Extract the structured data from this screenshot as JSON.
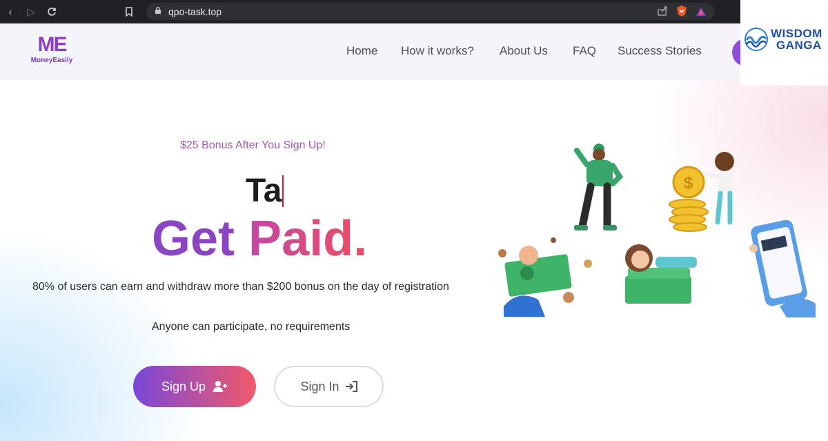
{
  "browser": {
    "url": "qpo-task.top",
    "icons": [
      "back-icon",
      "forward-icon",
      "reload-icon",
      "bookmark-icon",
      "lock-icon",
      "share-icon",
      "brave-shield-icon",
      "rewards-icon"
    ]
  },
  "watermark": {
    "line1": "WISDOM",
    "line2": "GANGA"
  },
  "site": {
    "logo_letters": "ME",
    "logo_name": "MoneyEasily",
    "nav": [
      "Home",
      "How it works?",
      "About Us",
      "FAQ",
      "Success Stories"
    ]
  },
  "hero": {
    "bonus_text": "$25 Bonus After You Sign Up!",
    "typed_text": "Ta",
    "headline_part1": "Get",
    "headline_part2": "Paid.",
    "subtitle1": "80% of users can earn and withdraw more than $200 bonus on the day of registration",
    "subtitle2": "Anyone can participate, no requirements",
    "signup_label": "Sign Up",
    "signin_label": "Sign In"
  },
  "colors": {
    "brand_purple": "#8b45c2",
    "gradient_start": "#7a47d9",
    "gradient_end": "#f15a6a",
    "bonus_text": "#a35aa6"
  }
}
